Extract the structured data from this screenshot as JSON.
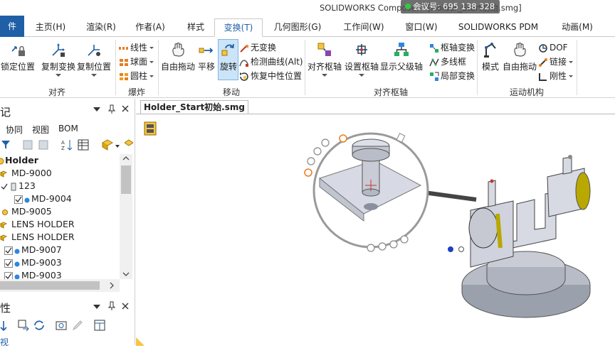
{
  "window": {
    "title": "SOLIDWORKS Composer - [Holder_Start初始.smg]",
    "meeting_overlay": "会议号: 695 138 328"
  },
  "tabs": [
    {
      "label": "件"
    },
    {
      "label": "主页(H)"
    },
    {
      "label": "渲染(R)"
    },
    {
      "label": "作者(A)"
    },
    {
      "label": "样式"
    },
    {
      "label": "变换(T)"
    },
    {
      "label": "几何图形(G)"
    },
    {
      "label": "工作间(W)"
    },
    {
      "label": "窗口(W)"
    },
    {
      "label": "SOLIDWORKS PDM"
    },
    {
      "label": "动画(M)"
    }
  ],
  "ribbon": {
    "groups": {
      "align": {
        "label": "对齐",
        "lock_position": "锁定位置",
        "copy_transform": "复制变换",
        "copy_position": "复制位置"
      },
      "explode": {
        "label": "爆炸",
        "linear": "线性",
        "spherical": "球面",
        "cylindrical": "圆柱"
      },
      "move": {
        "label": "移动",
        "free_drag": "自由拖动",
        "translate": "平移",
        "rotate": "旋转",
        "no_transform": "无变换",
        "detect_curve": "检测曲线(Alt)",
        "restore_neutral": "恢复中性位置"
      },
      "pivot": {
        "label": "对齐枢轴",
        "align_pivot": "对齐枢轴",
        "set_pivot": "设置枢轴",
        "show_parent_pivot": "显示父级轴",
        "pivot_transform": "枢轴变换",
        "polyline_frame": "多线框",
        "local_transform": "局部变换"
      },
      "kinematics": {
        "label": "运动机构",
        "mode": "模式",
        "free_drag": "自由拖动",
        "dof": "DOF",
        "link": "链接",
        "rigid": "刚性"
      }
    }
  },
  "left_pane": {
    "title": "记",
    "pane2_title": "性",
    "menu": [
      "协同",
      "视图",
      "BOM"
    ],
    "tree": [
      {
        "label": "Holder",
        "bold": true
      },
      {
        "label": "MD-9000"
      },
      {
        "label": "123"
      },
      {
        "label": "MD-9004"
      },
      {
        "label": "MD-9005"
      },
      {
        "label": "LENS HOLDER"
      },
      {
        "label": "LENS HOLDER"
      },
      {
        "label": "MD-9007"
      },
      {
        "label": "MD-9003"
      },
      {
        "label": "MD-9003"
      }
    ],
    "bottom_label": "视"
  },
  "document": {
    "tab_label": "Holder_Start初始.smg"
  },
  "colors": {
    "accent": "#1f5fa6",
    "active_tab_text": "#1f5fa6",
    "selected_pager_dot": "#1f3fbf"
  }
}
